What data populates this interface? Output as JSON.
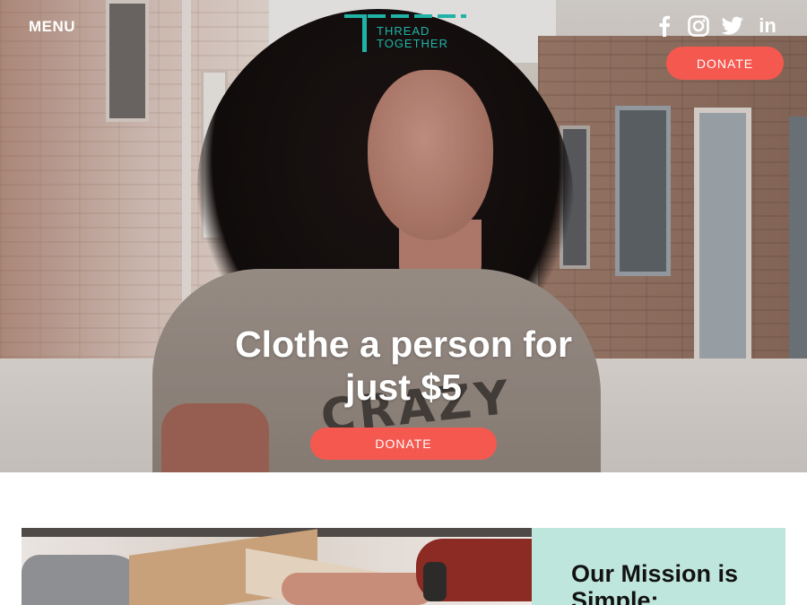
{
  "header": {
    "menu_label": "MENU",
    "logo": {
      "line1": "THREAD",
      "line2": "TOGETHER",
      "color": "#1fb3a7"
    },
    "social": [
      {
        "name": "facebook-icon",
        "glyph": "f"
      },
      {
        "name": "instagram-icon",
        "glyph": "◎"
      },
      {
        "name": "twitter-icon",
        "glyph": "🐦"
      },
      {
        "name": "linkedin-icon",
        "glyph": "in"
      }
    ],
    "donate_label": "DONATE"
  },
  "hero": {
    "heading_line1": "Clothe a person for",
    "heading_line2": "just $5",
    "shirt_print": "CRAZY",
    "donate_label": "DONATE"
  },
  "mission": {
    "title": "Our Mission is Simple:"
  },
  "colors": {
    "accent": "#f5584f",
    "brand_teal": "#1fb3a7",
    "mission_bg": "#bfe6dc"
  }
}
